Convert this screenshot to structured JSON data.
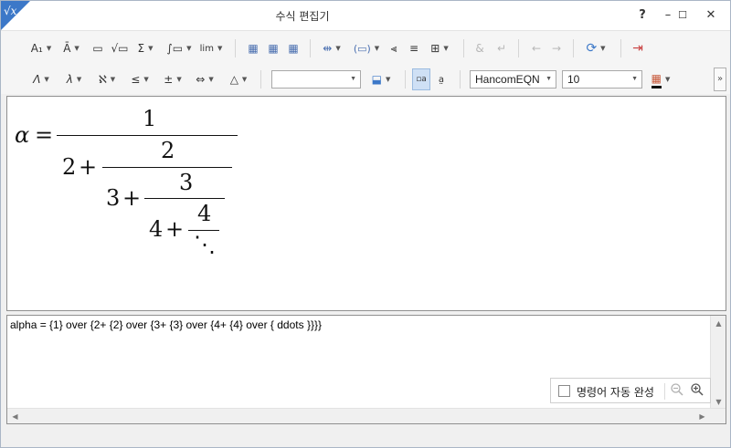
{
  "app": {
    "title": "수식 편집기",
    "logo_glyph": "√x",
    "accent": "#3c78c8"
  },
  "window_controls": {
    "help": "?",
    "minimize": "–",
    "maximize": "☐",
    "close": "✕"
  },
  "toolbar_row1": {
    "font_size_btn": "A₁",
    "decoration_btn": "Ā",
    "fraction_btn": "▭",
    "root_btn": "√▭",
    "sum_btn": "Σ",
    "integral_btn": "∫▭",
    "limit_btn": "lim",
    "matrix1_btn": "▦",
    "matrix2_btn": "▦",
    "matrix3_btn": "▦",
    "spacing_btn": "⇹",
    "bracket_btn": "(▭)",
    "align_left_btn": "⫷",
    "align_center_btn": "≡",
    "grid_btn": "⊞",
    "ampersand_btn": "&",
    "newline_btn": "↵",
    "undo_btn": "←",
    "redo_btn": "→",
    "refresh_btn": "⟳",
    "exit_btn": "⇥"
  },
  "toolbar_row2": {
    "greek_upper_btn": "Λ",
    "greek_lower_btn": "λ",
    "hebrew_btn": "ℵ",
    "relation_btn": "≤",
    "operator_btn": "±",
    "arrow_btn": "⇔",
    "misc_btn": "△",
    "style_combo": "",
    "color_btn": "⬓",
    "view1_btn": "▫a",
    "view2_btn": "a̤",
    "font_combo": "HancomEQN",
    "size_combo": "10",
    "text_color_btn": "▦"
  },
  "formula": {
    "alpha": "α",
    "eq": "=",
    "num1": "1",
    "t2": "2",
    "plus": "+",
    "num2": "2",
    "t3": "3",
    "num3": "3",
    "t4": "4",
    "num4": "4",
    "ddots": "⋱"
  },
  "script": {
    "text": "alpha = {1} over {2+ {2} over {3+ {3} over {4+ {4} over { ddots }}}}"
  },
  "autocomplete": {
    "label": "명령어 자동 완성",
    "checked": false,
    "zoom_out": "🔍",
    "zoom_in": "🔍"
  },
  "scroll": {
    "up": "▲",
    "down": "▼",
    "left": "◀",
    "right": "▶"
  }
}
